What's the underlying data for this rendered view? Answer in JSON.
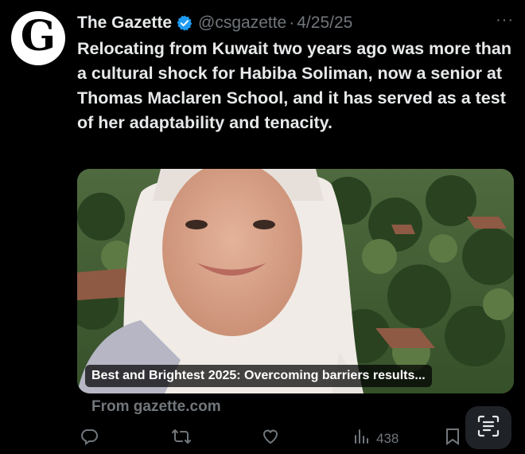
{
  "tweet": {
    "author_name": "The Gazette",
    "handle": "@csgazette",
    "separator": "·",
    "date": "4/25/25",
    "avatar_letter": "G",
    "more_label": "···",
    "text": "Relocating from Kuwait two years ago was more than a cultural shock for Habiba Soliman, now a senior at Thomas Maclaren School, and it has served as a test of her adaptability and tenacity."
  },
  "card": {
    "caption": "Best and Brightest 2025: Overcoming barriers results...",
    "source": "From gazette.com"
  },
  "actions": {
    "views_count": "438"
  },
  "icons": {
    "verified": "verified-badge-icon",
    "reply": "reply-icon",
    "repost": "repost-icon",
    "like": "like-icon",
    "views": "views-icon",
    "bookmark": "bookmark-icon",
    "more": "more-icon",
    "text_scan": "text-scan-icon"
  },
  "colors": {
    "background": "#000000",
    "text": "#e7e9ea",
    "muted": "#71767b",
    "verified": "#1d9bf0"
  }
}
